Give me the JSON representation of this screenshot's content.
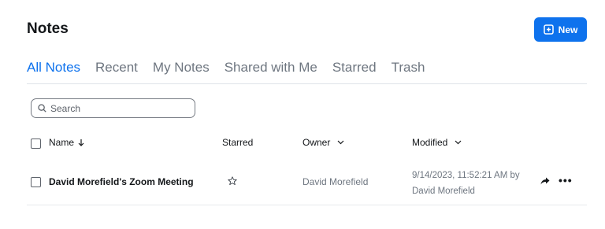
{
  "header": {
    "title": "Notes",
    "new_label": "New"
  },
  "tabs": [
    {
      "label": "All Notes",
      "active": true
    },
    {
      "label": "Recent",
      "active": false
    },
    {
      "label": "My Notes",
      "active": false
    },
    {
      "label": "Shared with Me",
      "active": false
    },
    {
      "label": "Starred",
      "active": false
    },
    {
      "label": "Trash",
      "active": false
    }
  ],
  "search": {
    "placeholder": "Search"
  },
  "table": {
    "columns": {
      "name": "Name",
      "starred": "Starred",
      "owner": "Owner",
      "modified": "Modified"
    },
    "rows": [
      {
        "name": "David Morefield's Zoom Meeting",
        "starred": false,
        "owner": "David Morefield",
        "modified_line1": "9/14/2023, 11:52:21 AM by",
        "modified_line2": "David Morefield"
      }
    ]
  },
  "colors": {
    "accent": "#0e72ed",
    "text": "#131619",
    "muted": "#6e7680"
  }
}
